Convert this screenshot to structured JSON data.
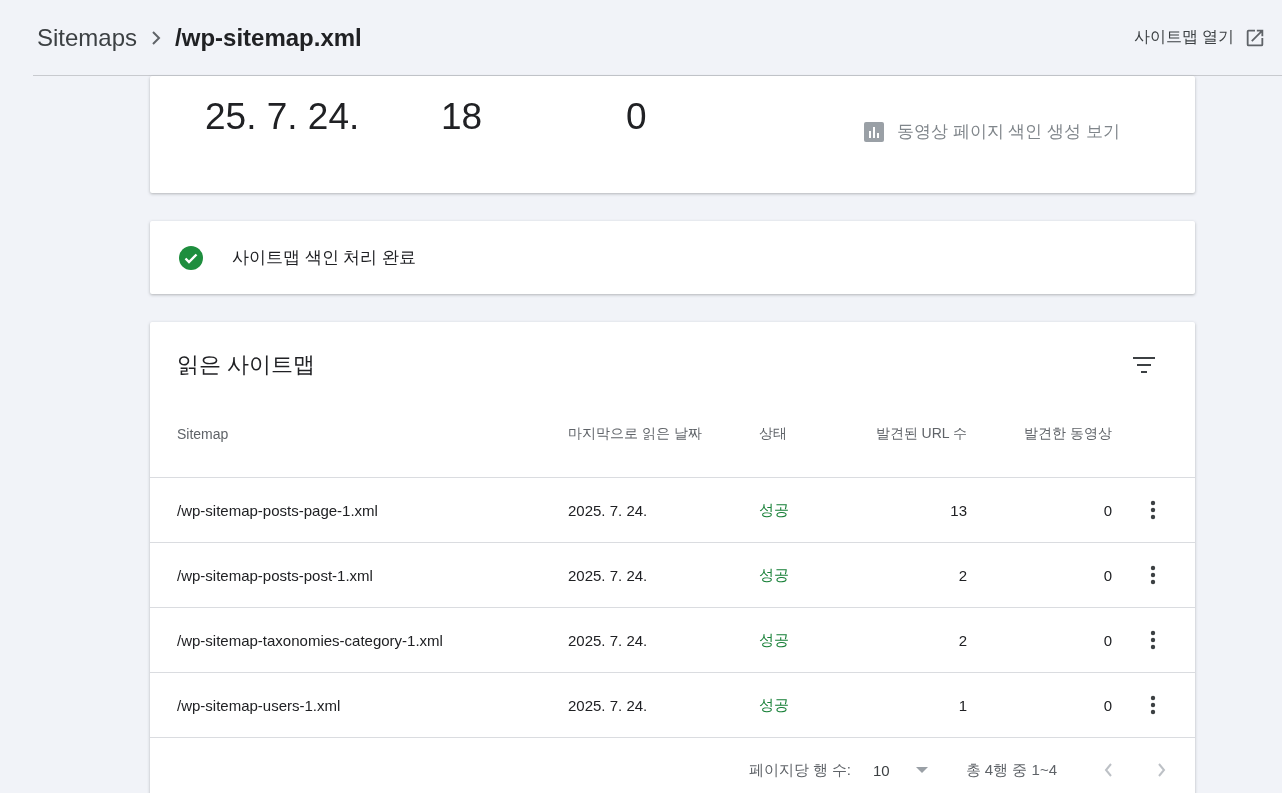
{
  "breadcrumb": {
    "parent": "Sitemaps",
    "current": "/wp-sitemap.xml"
  },
  "open_link": "사이트맵 열기",
  "summary": {
    "values": [
      "25. 7. 24.",
      "18",
      "0"
    ],
    "link": "동영상 페이지 색인 생성 보기"
  },
  "status_card": {
    "kind": "success",
    "text": "사이트맵 색인 처리 완료"
  },
  "table": {
    "title": "읽은 사이트맵",
    "columns": [
      "Sitemap",
      "마지막으로 읽은 날짜",
      "상태",
      "발견된 URL 수",
      "발견한 동영상"
    ],
    "rows": [
      {
        "sitemap": "/wp-sitemap-posts-page-1.xml",
        "date": "2025. 7. 24.",
        "status": "성공",
        "color": "#188038",
        "urls": "13",
        "videos": "0"
      },
      {
        "sitemap": "/wp-sitemap-posts-post-1.xml",
        "date": "2025. 7. 24.",
        "status": "성공",
        "color": "#188038",
        "urls": "2",
        "videos": "0"
      },
      {
        "sitemap": "/wp-sitemap-taxonomies-category-1.xml",
        "date": "2025. 7. 24.",
        "status": "성공",
        "color": "#188038",
        "urls": "2",
        "videos": "0"
      },
      {
        "sitemap": "/wp-sitemap-users-1.xml",
        "date": "2025. 7. 24.",
        "status": "성공",
        "color": "#188038",
        "urls": "1",
        "videos": "0"
      }
    ],
    "footer": {
      "rows_label": "페이지당 행 수:",
      "rows_value": "10",
      "range": "총 4행 중 1~4"
    }
  }
}
